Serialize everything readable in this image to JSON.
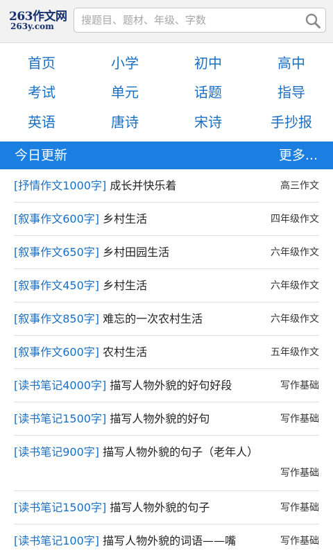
{
  "header": {
    "logo_main": "263作文网",
    "logo_sub": "263y.com",
    "search_placeholder": "搜题目、题材、年级、字数"
  },
  "nav": {
    "items": [
      "首页",
      "小学",
      "初中",
      "高中",
      "考试",
      "单元",
      "话题",
      "指导",
      "英语",
      "唐诗",
      "宋诗",
      "手抄报"
    ]
  },
  "section": {
    "title": "今日更新",
    "more": "更多..."
  },
  "list": [
    {
      "tag": "[抒情作文1000字]",
      "title": "成长并快乐着",
      "category": "高三作文"
    },
    {
      "tag": "[叙事作文600字]",
      "title": "乡村生活",
      "category": "四年级作文"
    },
    {
      "tag": "[叙事作文650字]",
      "title": "乡村田园生活",
      "category": "六年级作文"
    },
    {
      "tag": "[叙事作文450字]",
      "title": "乡村生活",
      "category": "六年级作文"
    },
    {
      "tag": "[叙事作文850字]",
      "title": "难忘的一次农村生活",
      "category": "六年级作文"
    },
    {
      "tag": "[叙事作文600字]",
      "title": "农村生活",
      "category": "五年级作文"
    },
    {
      "tag": "[读书笔记4000字]",
      "title": "描写人物外貌的好句好段",
      "category": "写作基础"
    },
    {
      "tag": "[读书笔记1500字]",
      "title": "描写人物外貌的好句",
      "category": "写作基础"
    },
    {
      "tag": "[读书笔记900字]",
      "title": "描写人物外貌的句子（老年人）",
      "category": "写作基础"
    },
    {
      "tag": "[读书笔记1500字]",
      "title": "描写人物外貌的句子",
      "category": "写作基础"
    },
    {
      "tag": "[读书笔记100字]",
      "title": "描写人物外貌的词语——嘴",
      "category": "写作基础"
    }
  ],
  "colors": {
    "link_blue": "#1a6fc4",
    "section_bar": "#1a7fe0",
    "logo_navy": "#14306e"
  }
}
